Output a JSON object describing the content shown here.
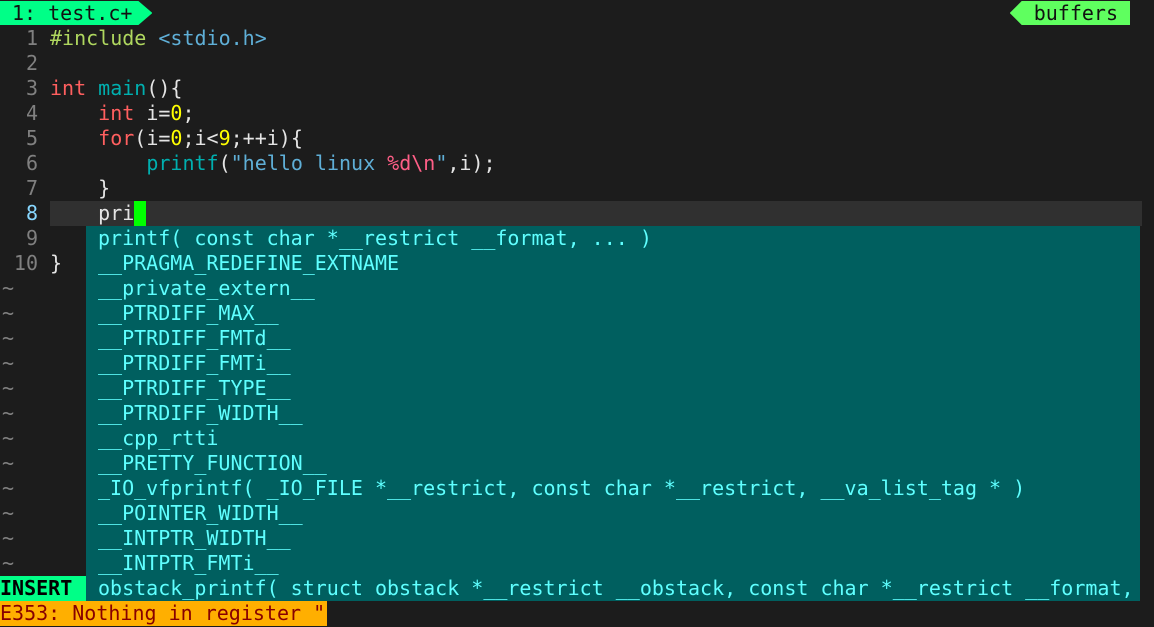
{
  "tabline": {
    "left": "1: test.c+",
    "right": "buffers"
  },
  "colors": {
    "tab_active": "#00ff87",
    "buffers": "#5fff5f",
    "popup_bg": "#005f5f",
    "popup_fg": "#5fffff",
    "cursor": "#00ff00",
    "error_bg": "#ffaf00",
    "error_fg": "#870000"
  },
  "lines": [
    {
      "n": "1",
      "tokens": [
        {
          "t": "#include ",
          "c": "pre"
        },
        {
          "t": "<stdio.h>",
          "c": "inc"
        }
      ]
    },
    {
      "n": "2",
      "tokens": []
    },
    {
      "n": "3",
      "tokens": [
        {
          "t": "int",
          "c": "kw"
        },
        {
          "t": " ",
          "c": "n"
        },
        {
          "t": "main",
          "c": "fn"
        },
        {
          "t": "(){",
          "c": "n"
        }
      ]
    },
    {
      "n": "4",
      "tokens": [
        {
          "t": "    ",
          "c": "n"
        },
        {
          "t": "int",
          "c": "kw"
        },
        {
          "t": " i=",
          "c": "n"
        },
        {
          "t": "0",
          "c": "num"
        },
        {
          "t": ";",
          "c": "n"
        }
      ]
    },
    {
      "n": "5",
      "tokens": [
        {
          "t": "    ",
          "c": "n"
        },
        {
          "t": "for",
          "c": "kw"
        },
        {
          "t": "(i=",
          "c": "n"
        },
        {
          "t": "0",
          "c": "num"
        },
        {
          "t": ";i<",
          "c": "n"
        },
        {
          "t": "9",
          "c": "num"
        },
        {
          "t": ";++i){",
          "c": "n"
        }
      ]
    },
    {
      "n": "6",
      "tokens": [
        {
          "t": "        ",
          "c": "n"
        },
        {
          "t": "printf",
          "c": "fn"
        },
        {
          "t": "(",
          "c": "n"
        },
        {
          "t": "\"hello linux ",
          "c": "str"
        },
        {
          "t": "%d\\n",
          "c": "fmt"
        },
        {
          "t": "\"",
          "c": "str"
        },
        {
          "t": ",i);",
          "c": "n"
        }
      ]
    },
    {
      "n": "7",
      "tokens": [
        {
          "t": "    }",
          "c": "n"
        }
      ]
    },
    {
      "n": "8",
      "tokens": [
        {
          "t": "    pri",
          "c": "n"
        }
      ],
      "current": true
    },
    {
      "n": "9",
      "tokens": []
    },
    {
      "n": "10",
      "tokens": [
        {
          "t": "}",
          "c": "n"
        }
      ]
    }
  ],
  "tildes": [
    "~",
    "~",
    "~",
    "~",
    "~",
    "~",
    "~",
    "~",
    "~",
    "~",
    "~",
    "~"
  ],
  "popup": [
    "printf( const char *__restrict __format, ... )",
    "__PRAGMA_REDEFINE_EXTNAME",
    "__private_extern__",
    "__PTRDIFF_MAX__",
    "__PTRDIFF_FMTd__",
    "__PTRDIFF_FMTi__",
    "__PTRDIFF_TYPE__",
    "__PTRDIFF_WIDTH__",
    "__cpp_rtti",
    "__PRETTY_FUNCTION__",
    "_IO_vfprintf( _IO_FILE *__restrict, const char *__restrict, __va_list_tag * )",
    "__POINTER_WIDTH__",
    "__INTPTR_WIDTH__",
    "__INTPTR_FMTi__",
    "obstack_printf( struct obstack *__restrict __obstack, const char *__restrict __format,"
  ],
  "status": {
    "mode": " INSERT",
    "message": "E353: Nothing in register \""
  }
}
